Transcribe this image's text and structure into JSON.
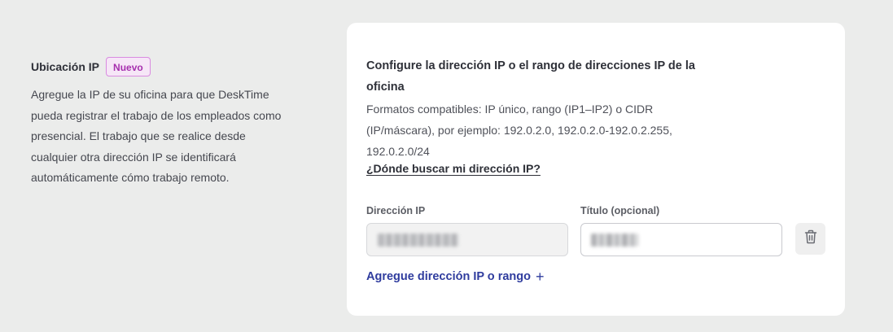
{
  "location": {
    "title": "Ubicación IP",
    "badge": "Nuevo",
    "description": "Agregue la IP de su oficina para que DeskTime pueda registrar el trabajo de los empleados como presencial. El trabajo que se realice desde cualquier otra dirección IP se identificará automáticamente cómo trabajo remoto."
  },
  "card": {
    "title": "Configure la dirección IP o el rango de direcciones IP de la oficina",
    "description": "Formatos compatibles: IP único, rango (IP1–IP2) o CIDR (IP/máscara), por ejemplo: 192.0.2.0, 192.0.2.0-192.0.2.255, 192.0.2.0/24",
    "help_link": "¿Dónde buscar mi dirección IP?",
    "fields": {
      "ip_label": "Dirección IP",
      "title_label": "Título (opcional)"
    },
    "add_link": "Agregue dirección IP o rango",
    "icons": {
      "delete": "trash-icon",
      "add": "plus-icon"
    }
  },
  "colors": {
    "accent": "#2f3c9e",
    "badge_bg": "#f6e6f7",
    "badge_text": "#a62fae",
    "page_bg": "#ebeceb"
  }
}
